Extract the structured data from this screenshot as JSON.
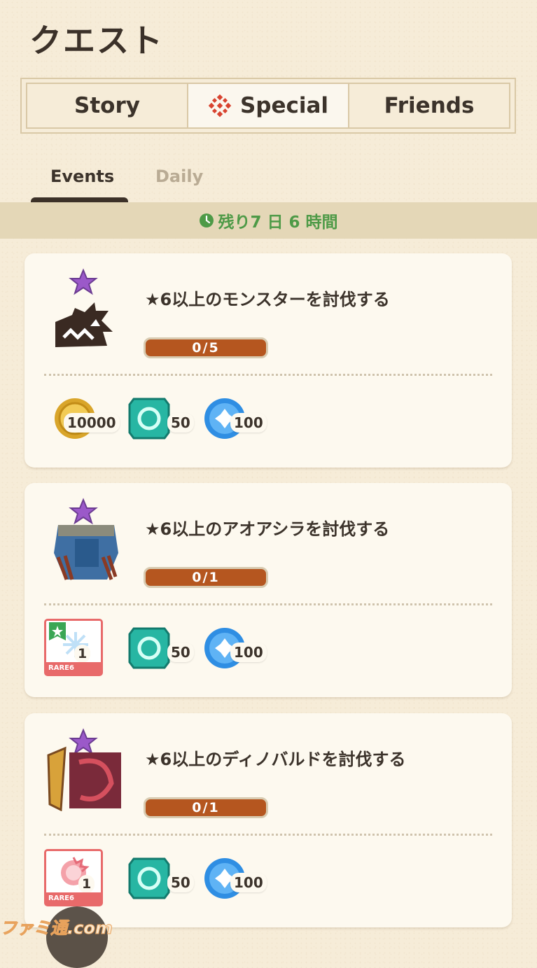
{
  "page_title": "クエスト",
  "segments": [
    "Story",
    "Special",
    "Friends"
  ],
  "active_segment": "Special",
  "subtabs": [
    "Events",
    "Daily"
  ],
  "active_subtab": "Events",
  "time_remaining": "残り7 日 6 時間",
  "quests": [
    {
      "title": "★6以上のモンスターを討伐する",
      "progress_text": "0/5",
      "progress": 0,
      "rewards": [
        {
          "icon": "gold-coin-icon",
          "qty": "10000"
        },
        {
          "icon": "gem-icon",
          "qty": "50"
        },
        {
          "icon": "blue-orb-icon",
          "qty": "100"
        }
      ]
    },
    {
      "title": "★6以上のアオアシラを討伐する",
      "progress_text": "0/1",
      "progress": 0,
      "rewards": [
        {
          "icon": "rare-card-icon",
          "qty": "1",
          "label": "RARE6"
        },
        {
          "icon": "gem-icon",
          "qty": "50"
        },
        {
          "icon": "blue-orb-icon",
          "qty": "100"
        }
      ]
    },
    {
      "title": "★6以上のディノバルドを討伐する",
      "progress_text": "0/1",
      "progress": 0,
      "rewards": [
        {
          "icon": "rare-card-icon",
          "qty": "1",
          "label": "RARE6"
        },
        {
          "icon": "gem-icon",
          "qty": "50"
        },
        {
          "icon": "blue-orb-icon",
          "qty": "100"
        }
      ]
    }
  ],
  "watermark": "ファミ通.com",
  "colors": {
    "accent_green": "#4e9a47",
    "progress": "#b5561f",
    "rare": "#e86a6a"
  }
}
